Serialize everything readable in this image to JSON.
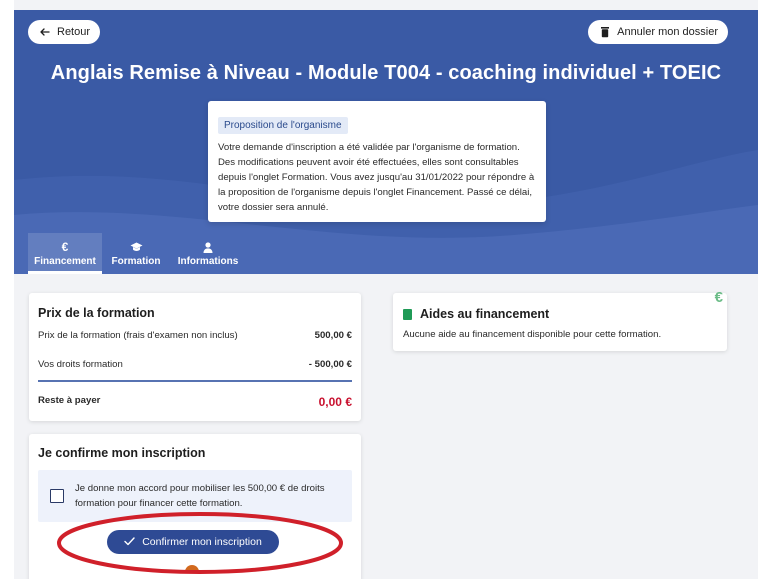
{
  "header": {
    "back_label": "Retour",
    "cancel_label": "Annuler mon dossier",
    "title": "Anglais Remise à Niveau - Module T004 - coaching individuel + TOEIC",
    "bg_color": "#3a5aa5"
  },
  "notice": {
    "tag": "Proposition de l'organisme",
    "text": "Votre demande d'inscription a été validée par l'organisme de formation. Des modifications peuvent avoir été effectuées, elles sont consultables depuis l'onglet Formation. Vous avez jusqu'au 31/01/2022 pour répondre à la proposition de l'organisme depuis l'onglet Financement. Passé ce délai, votre dossier sera annulé."
  },
  "tabs": [
    {
      "label": "Financement",
      "icon": "euro-icon",
      "glyph": "€",
      "active": true
    },
    {
      "label": "Formation",
      "icon": "graduation-cap-icon",
      "active": false
    },
    {
      "label": "Informations",
      "icon": "user-icon",
      "active": false
    }
  ],
  "price": {
    "title": "Prix de la formation",
    "rows": [
      {
        "label": "Prix de la formation (frais d'examen non inclus)",
        "amount": "500,00 €"
      },
      {
        "label": "Vos droits formation",
        "amount": "- 500,00 €"
      }
    ],
    "total_label": "Reste à payer",
    "total_amount": "0,00 €"
  },
  "aid": {
    "title": "Aides au financement",
    "text": "Aucune aide au financement disponible pour cette formation.",
    "badge": "€"
  },
  "confirm": {
    "title": "Je confirme mon inscription",
    "consent": "Je donne mon accord pour mobiliser les 500,00 € de droits formation pour financer cette formation.",
    "button_label": "Confirmer mon inscription",
    "checked": false
  },
  "colors": {
    "primary": "#2e4a94",
    "accent_red": "#c8102e",
    "annotation": "#d0202a"
  }
}
